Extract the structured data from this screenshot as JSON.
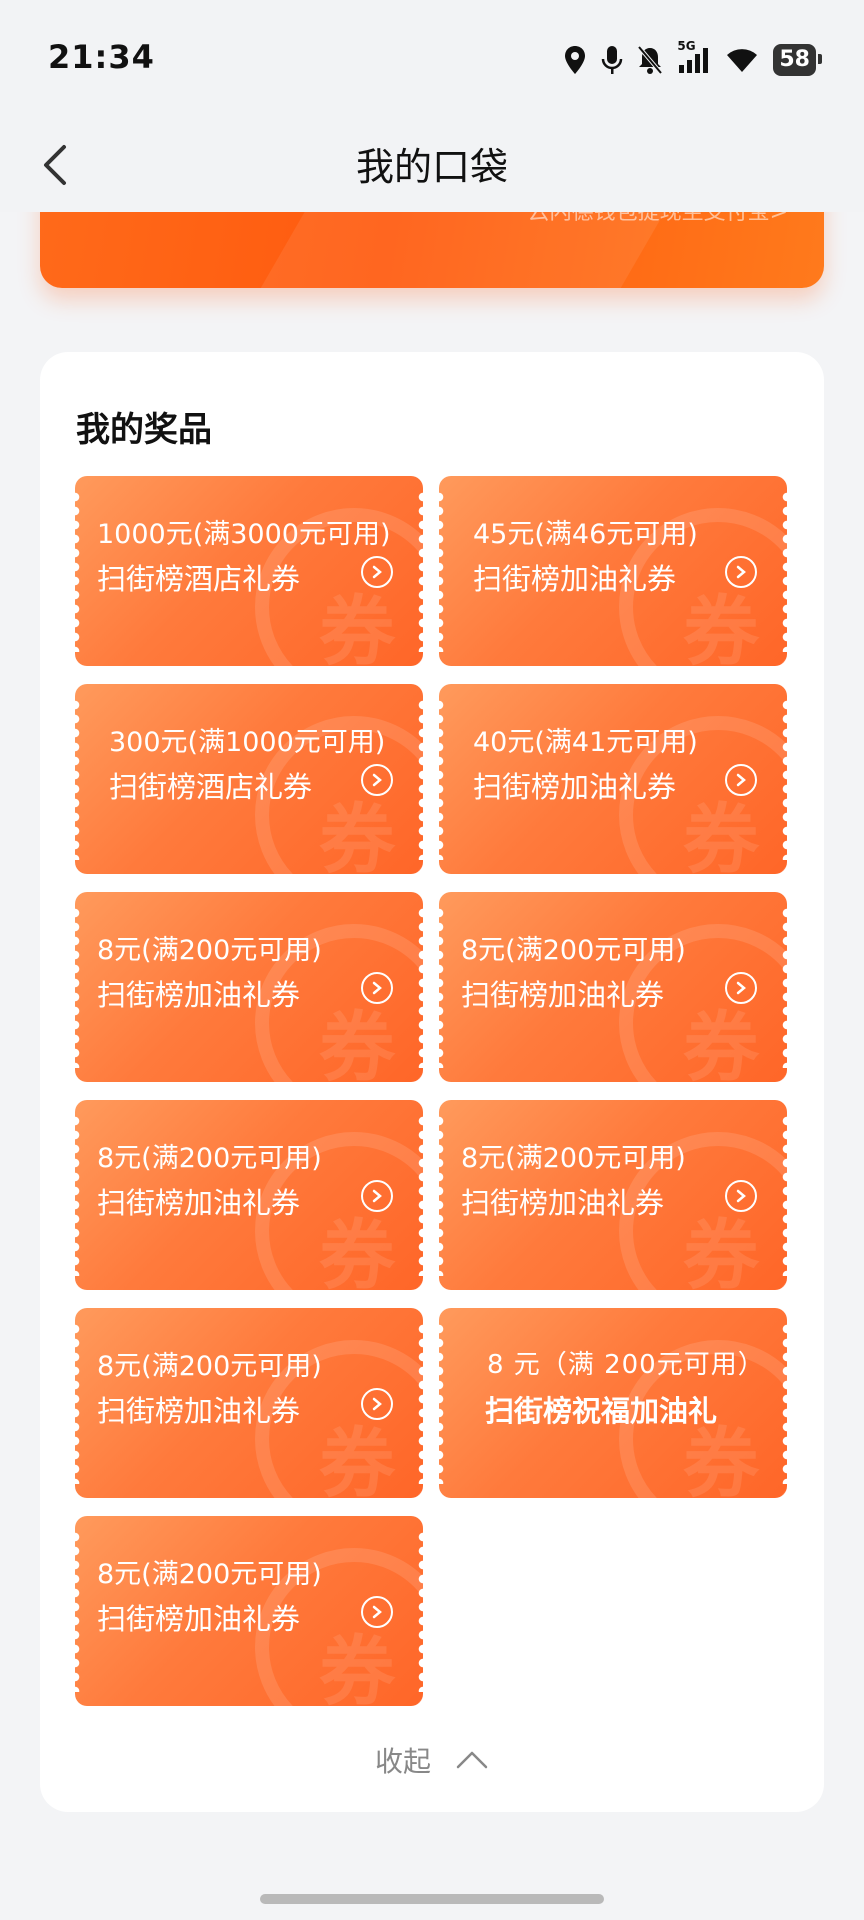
{
  "status_bar": {
    "time": "21:34",
    "network": "5G",
    "battery": "58",
    "icons": [
      "location-icon",
      "microphone-icon",
      "mute-bell-icon",
      "signal-icon",
      "wifi-icon",
      "battery-icon"
    ]
  },
  "nav": {
    "title": "我的口袋",
    "back_icon": "chevron-left-icon"
  },
  "banner": {
    "link_text": "云闪德钱包提现至支付宝>"
  },
  "prizes": {
    "section_title": "我的奖品",
    "coupons": [
      {
        "line1": "1000元(满3000元可用)",
        "line2": "扫街榜酒店礼券"
      },
      {
        "line1": "45元(满46元可用)",
        "line2": "扫街榜加油礼券"
      },
      {
        "line1": "300元(满1000元可用)",
        "line2": "扫街榜酒店礼券"
      },
      {
        "line1": "40元(满41元可用)",
        "line2": "扫街榜加油礼券"
      },
      {
        "line1": "8元(满200元可用)",
        "line2": "扫街榜加油礼券"
      },
      {
        "line1": "8元(满200元可用)",
        "line2": "扫街榜加油礼券"
      },
      {
        "line1": "8元(满200元可用)",
        "line2": "扫街榜加油礼券"
      },
      {
        "line1": "8元(满200元可用)",
        "line2": "扫街榜加油礼券"
      },
      {
        "line1": "8元(满200元可用)",
        "line2": "扫街榜加油礼券"
      },
      {
        "line1": "8 元（满 200元可用）",
        "line2": "扫街榜祝福加油礼"
      },
      {
        "line1": "8元(满200元可用)",
        "line2": "扫街榜加油礼券"
      }
    ],
    "watermark_char": "券",
    "collapse_label": "收起"
  },
  "colors": {
    "accent": "#ff6a1a",
    "coupon_light": "#ff9a5c",
    "coupon_dark": "#ff6628"
  }
}
